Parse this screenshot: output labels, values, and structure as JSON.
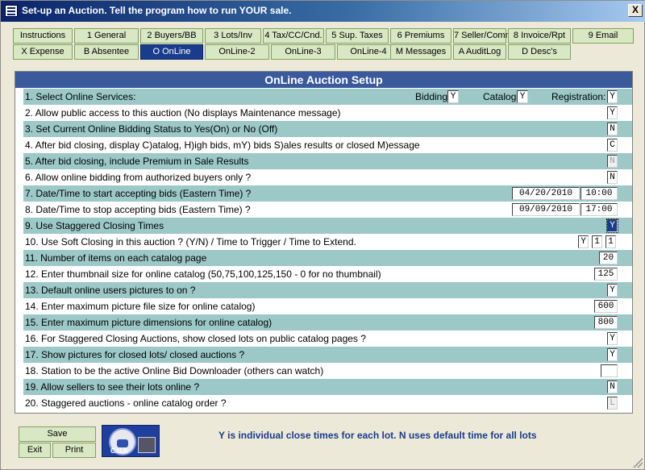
{
  "window": {
    "title": "Set-up an Auction.  Tell the program how to run YOUR sale.",
    "close_label": "X"
  },
  "tabs_row1": [
    {
      "label": "Instructions"
    },
    {
      "label": "1 General"
    },
    {
      "label": "2 Buyers/BB"
    },
    {
      "label": "3 Lots/Inv"
    },
    {
      "label": "4 Tax/CC/Cnd."
    },
    {
      "label": "5 Sup. Taxes"
    },
    {
      "label": "6 Premiums"
    },
    {
      "label": "7 Seller/Comm"
    },
    {
      "label": "8 Invoice/Rpt"
    },
    {
      "label": "9 Email"
    }
  ],
  "tabs_row2": [
    {
      "label": "X Expense"
    },
    {
      "label": "B Absentee"
    },
    {
      "label": "O OnLine",
      "active": true
    },
    {
      "label": "OnLine-2"
    },
    {
      "label": "OnLine-3"
    },
    {
      "label": "OnLine-4"
    },
    {
      "label": "M Messages"
    },
    {
      "label": "A AuditLog"
    },
    {
      "label": "D Desc's"
    }
  ],
  "panel": {
    "title": "OnLine Auction Setup"
  },
  "settings": [
    {
      "label": "1. Select Online Services:",
      "bidding_label": "Bidding:",
      "bidding": "Y",
      "catalog_label": "Catalog:",
      "catalog": "Y",
      "registration_label": "Registration:",
      "registration": "Y"
    },
    {
      "label": "2. Allow public access to this auction (No displays Maintenance message)",
      "value": "Y"
    },
    {
      "label": "3. Set Current Online Bidding Status to Yes(On) or No (Off)",
      "value": "N"
    },
    {
      "label": "4. After bid closing, display C)atalog, H)igh bids, mY) bids S)ales results or closed M)essage",
      "value": "C"
    },
    {
      "label": "5. After bid closing, include Premium in Sale Results",
      "value": "N"
    },
    {
      "label": "6. Allow online bidding from authorized buyers only ?",
      "value": "N"
    },
    {
      "label": "7. Date/Time to start accepting bids (Eastern Time) ?",
      "date": "04/20/2010",
      "time": "10:00"
    },
    {
      "label": "8. Date/Time to stop accepting bids (Eastern Time) ?",
      "date": "09/09/2010",
      "time": "17:00"
    },
    {
      "label": "9. Use Staggered Closing Times",
      "value": "Y"
    },
    {
      "label": "10. Use Soft Closing in this auction ?  (Y/N) / Time to Trigger / Time to Extend.",
      "v1": "Y",
      "v2": "1",
      "v3": "1"
    },
    {
      "label": "11. Number of items on each catalog page",
      "value": "20"
    },
    {
      "label": "12. Enter thumbnail size for online catalog (50,75,100,125,150 - 0 for no thumbnail)",
      "value": "125"
    },
    {
      "label": "13. Default online users pictures to on ?",
      "value": "Y"
    },
    {
      "label": "14. Enter maximum picture file size for online catalog)",
      "value": "600"
    },
    {
      "label": "15. Enter maximum picture dimensions for online catalog)",
      "value": "800"
    },
    {
      "label": "16. For Staggered Closing Auctions, show closed lots on public catalog pages ?",
      "value": "Y"
    },
    {
      "label": "17. Show pictures for closed lots/ closed auctions ?",
      "value": "Y"
    },
    {
      "label": "18. Station to be the active Online Bid Downloader (others can watch)",
      "value": ""
    },
    {
      "label": "19. Allow sellers to see their lots online ?",
      "value": "N"
    },
    {
      "label": "20. Staggered auctions - online catalog order ?",
      "value": "L"
    }
  ],
  "buttons": {
    "save": "Save",
    "exit": "Exit",
    "print": "Print"
  },
  "logo": {
    "text": "C.U.S"
  },
  "hint": "Y is individual close times for each lot. N uses default time for all lots"
}
